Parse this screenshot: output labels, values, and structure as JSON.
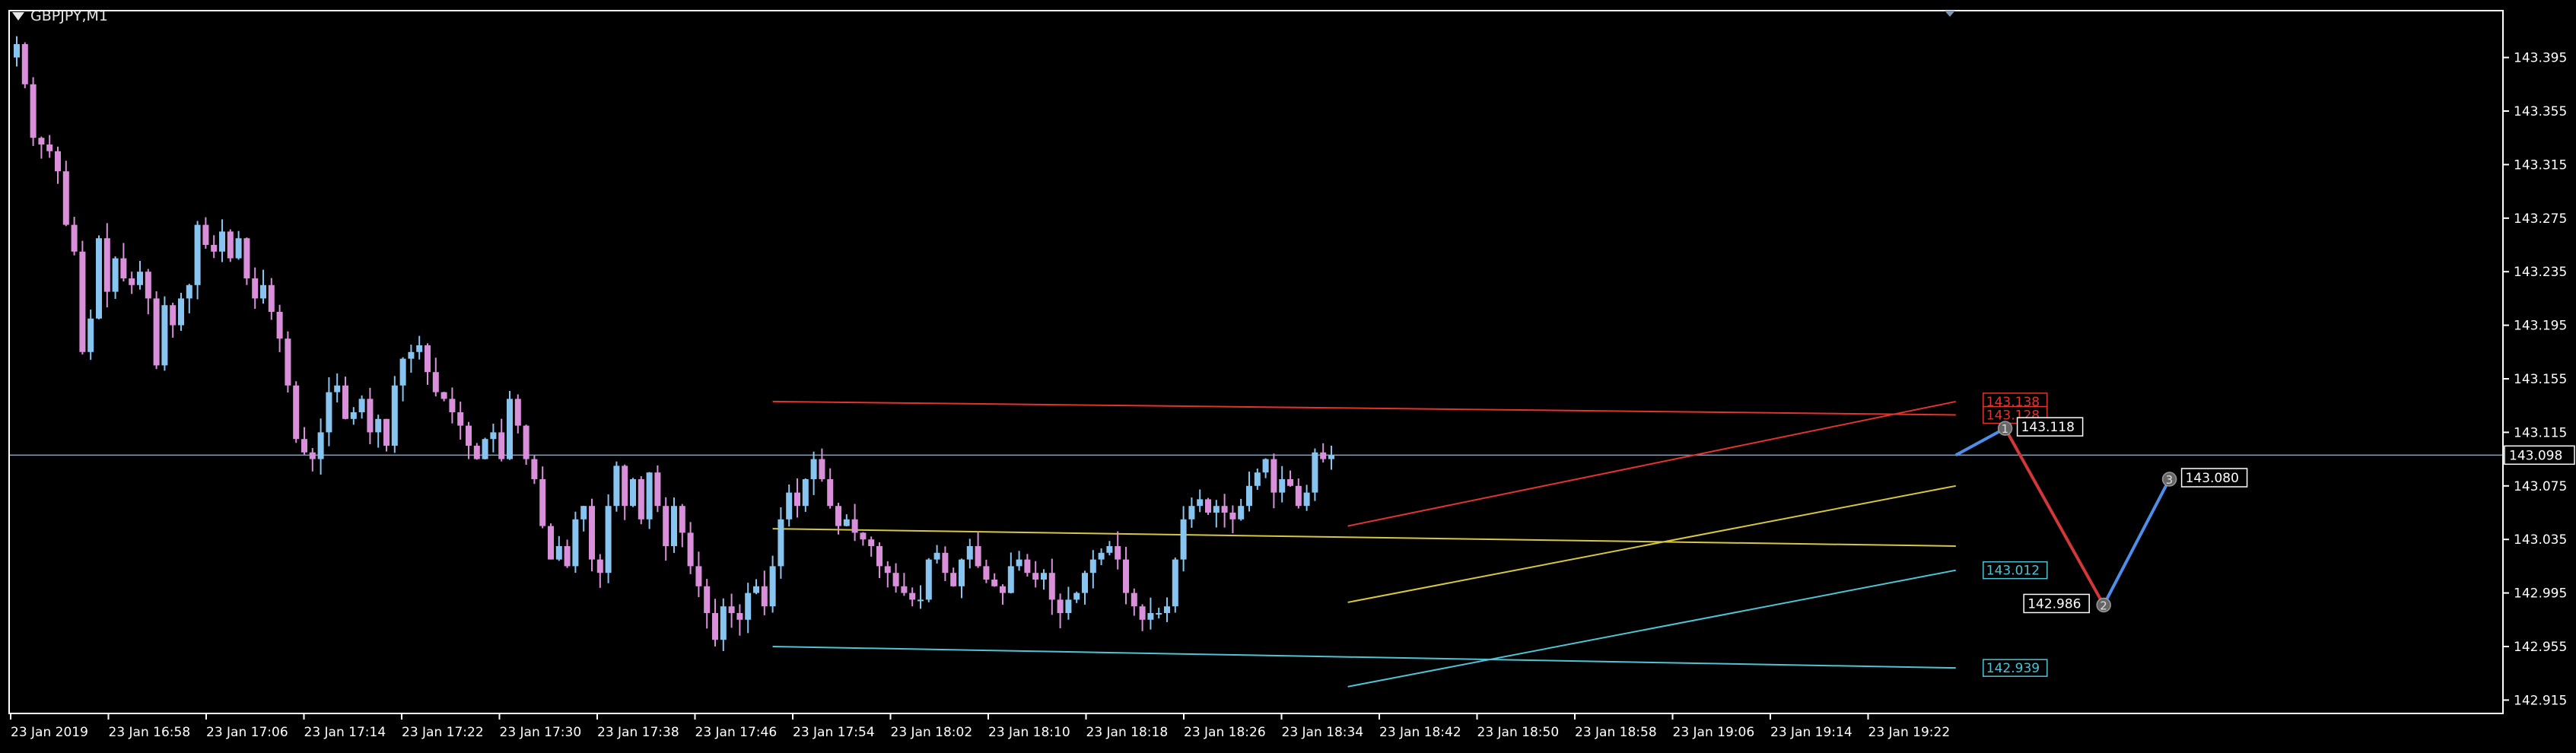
{
  "header": {
    "symbol": "GBPJPY,M1",
    "menu_icon": "chevron-down-icon"
  },
  "chart_data": {
    "type": "candlestick",
    "symbol": "GBPJPY",
    "timeframe": "M1",
    "colors": {
      "background": "#000000",
      "frame": "#ffffff",
      "bull": "#87c4f0",
      "bear": "#d98fd9",
      "bid_line": "#8ea2b8",
      "red_line": "#e0342d",
      "yellow_line": "#d6c640",
      "cyan_line": "#4fc3d6",
      "zigzag_down": "#d23838",
      "zigzag_up": "#4f8ee8",
      "label_text": "#ffffff"
    },
    "ylim": [
      142.905,
      143.43
    ],
    "y_ticks": [
      "143.395",
      "143.355",
      "143.315",
      "143.275",
      "143.235",
      "143.195",
      "143.155",
      "143.115",
      "143.075",
      "143.035",
      "142.995",
      "142.955",
      "142.915"
    ],
    "x_tick_labels": [
      "23 Jan 2019",
      "23 Jan 16:58",
      "23 Jan 17:06",
      "23 Jan 17:14",
      "23 Jan 17:22",
      "23 Jan 17:30",
      "23 Jan 17:38",
      "23 Jan 17:46",
      "23 Jan 17:54",
      "23 Jan 18:02",
      "23 Jan 18:10",
      "23 Jan 18:18",
      "23 Jan 18:26",
      "23 Jan 18:34",
      "23 Jan 18:42",
      "23 Jan 18:50",
      "23 Jan 18:58",
      "23 Jan 19:06",
      "23 Jan 19:14",
      "23 Jan 19:22"
    ],
    "bid": 143.098,
    "candle_closes": [
      143.405,
      143.375,
      143.335,
      143.33,
      143.325,
      143.31,
      143.27,
      143.25,
      143.175,
      143.2,
      143.26,
      143.22,
      143.245,
      143.23,
      143.225,
      143.235,
      143.215,
      143.165,
      143.21,
      143.195,
      143.215,
      143.225,
      143.27,
      143.255,
      143.25,
      143.265,
      143.245,
      143.26,
      143.23,
      143.215,
      143.225,
      143.205,
      143.185,
      143.15,
      143.11,
      143.1,
      143.095,
      143.115,
      143.145,
      143.15,
      143.125,
      143.13,
      143.14,
      143.115,
      143.125,
      143.105,
      143.15,
      143.17,
      143.175,
      143.18,
      143.16,
      143.145,
      143.14,
      143.13,
      143.12,
      143.105,
      143.095,
      143.11,
      143.115,
      143.095,
      143.14,
      143.12,
      143.095,
      143.08,
      143.045,
      143.02,
      143.03,
      143.015,
      143.05,
      143.06,
      143.02,
      143.01,
      143.06,
      143.09,
      143.06,
      143.08,
      143.05,
      143.085,
      143.06,
      143.03,
      143.06,
      143.04,
      143.015,
      143.0,
      142.98,
      142.96,
      142.985,
      142.98,
      142.975,
      142.995,
      143.0,
      142.985,
      143.015,
      143.05,
      143.07,
      143.06,
      143.08,
      143.095,
      143.08,
      143.06,
      143.045,
      143.05,
      143.04,
      143.035,
      143.03,
      143.015,
      143.01,
      143.0,
      142.995,
      142.99,
      142.99,
      143.02,
      143.025,
      143.01,
      143.0,
      143.02,
      143.03,
      143.015,
      143.005,
      143.0,
      142.995,
      143.015,
      143.02,
      143.01,
      143.005,
      143.01,
      142.99,
      142.98,
      142.99,
      142.995,
      143.01,
      143.02,
      143.025,
      143.03,
      143.02,
      142.995,
      142.985,
      142.975,
      142.98,
      142.98,
      142.985,
      143.02,
      143.05,
      143.06,
      143.065,
      143.055,
      143.06,
      143.055,
      143.05,
      143.06,
      143.075,
      143.085,
      143.095,
      143.07,
      143.08,
      143.075,
      143.06,
      143.07,
      143.1,
      143.095,
      143.098
    ],
    "lines": [
      {
        "name": "red_resistance",
        "color": "red",
        "from": {
          "i": 92,
          "p": 143.138
        },
        "to": {
          "i": 236,
          "p": 143.128
        }
      },
      {
        "name": "red_channel_top",
        "color": "red",
        "from": {
          "i": 162,
          "p": 143.045
        },
        "to": {
          "i": 236,
          "p": 143.138
        }
      },
      {
        "name": "yellow_horizontal",
        "color": "yellow",
        "from": {
          "i": 92,
          "p": 143.043
        },
        "to": {
          "i": 236,
          "p": 143.03
        }
      },
      {
        "name": "yellow_channel",
        "color": "yellow",
        "from": {
          "i": 162,
          "p": 142.988
        },
        "to": {
          "i": 236,
          "p": 143.075
        }
      },
      {
        "name": "cyan_channel",
        "color": "cyan",
        "from": {
          "i": 162,
          "p": 142.925
        },
        "to": {
          "i": 236,
          "p": 143.012
        }
      },
      {
        "name": "cyan_support",
        "color": "cyan",
        "from": {
          "i": 92,
          "p": 142.955
        },
        "to": {
          "i": 236,
          "p": 142.939
        }
      }
    ],
    "line_labels": [
      {
        "text": "143.138",
        "price": 143.138,
        "color": "red"
      },
      {
        "text": "143.128",
        "price": 143.128,
        "color": "red"
      },
      {
        "text": "143.012",
        "price": 143.012,
        "color": "cyan"
      },
      {
        "text": "142.939",
        "price": 142.939,
        "color": "cyan"
      }
    ],
    "zigzag": [
      {
        "label": "",
        "i": 236,
        "p": 143.098
      },
      {
        "label": "1",
        "i": 242,
        "p": 143.118,
        "value_text": "143.118"
      },
      {
        "label": "2",
        "i": 254,
        "p": 142.986,
        "value_text": "142.986"
      },
      {
        "label": "3",
        "i": 262,
        "p": 143.08,
        "value_text": "143.080"
      }
    ]
  }
}
